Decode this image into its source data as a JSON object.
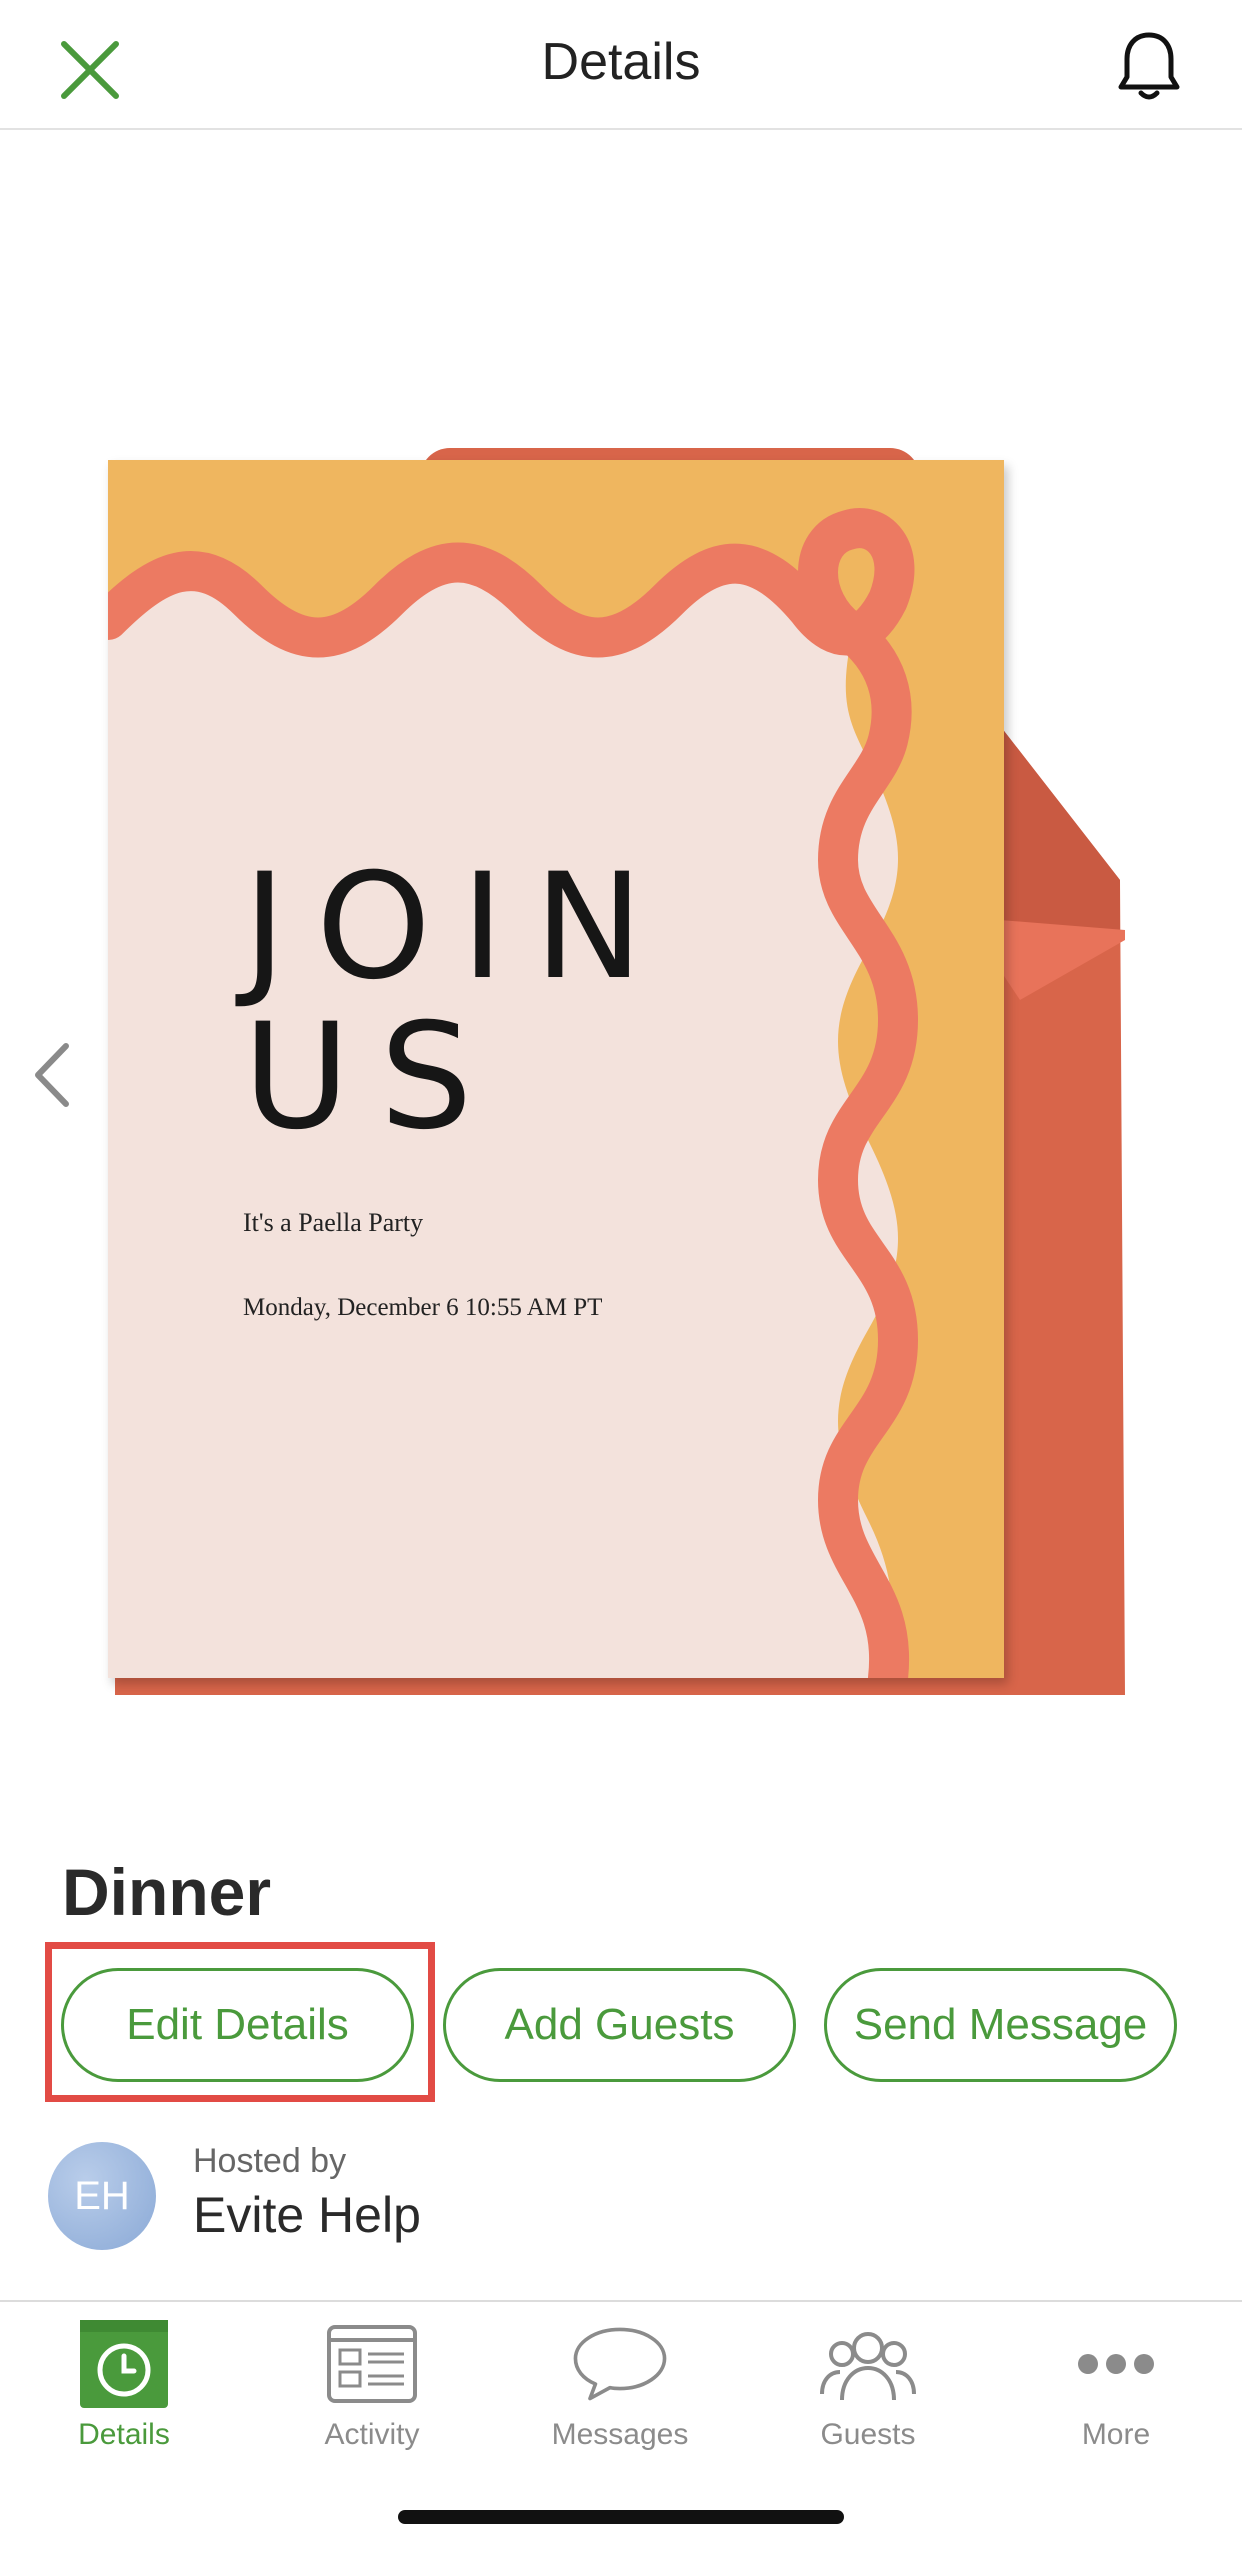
{
  "header": {
    "title": "Details",
    "close_icon": "close-icon",
    "bell_icon": "bell-icon"
  },
  "invitation": {
    "headline_line1": "JOIN",
    "headline_line2": "US",
    "party_name": "It's a Paella Party",
    "date_time": "Monday, December 6 10:55 AM PT",
    "colors": {
      "background": "#efb65f",
      "paper": "#f3e2dc",
      "wave": "#ec7a62",
      "envelope": "#d8654a"
    }
  },
  "event": {
    "title": "Dinner"
  },
  "actions": [
    {
      "label": "Edit Details"
    },
    {
      "label": "Add Guests"
    },
    {
      "label": "Send Message"
    }
  ],
  "host": {
    "hosted_label": "Hosted by",
    "name": "Evite Help",
    "initials": "EH"
  },
  "tabs": [
    {
      "label": "Details",
      "icon": "clock-icon",
      "active": true
    },
    {
      "label": "Activity",
      "icon": "activity-icon",
      "active": false
    },
    {
      "label": "Messages",
      "icon": "chat-bubble-icon",
      "active": false
    },
    {
      "label": "Guests",
      "icon": "guests-icon",
      "active": false
    },
    {
      "label": "More",
      "icon": "more-dots-icon",
      "active": false
    }
  ],
  "theme": {
    "accent": "#4a9a3c",
    "highlight": "#e24b45",
    "tab_inactive": "#8b8b8b"
  }
}
